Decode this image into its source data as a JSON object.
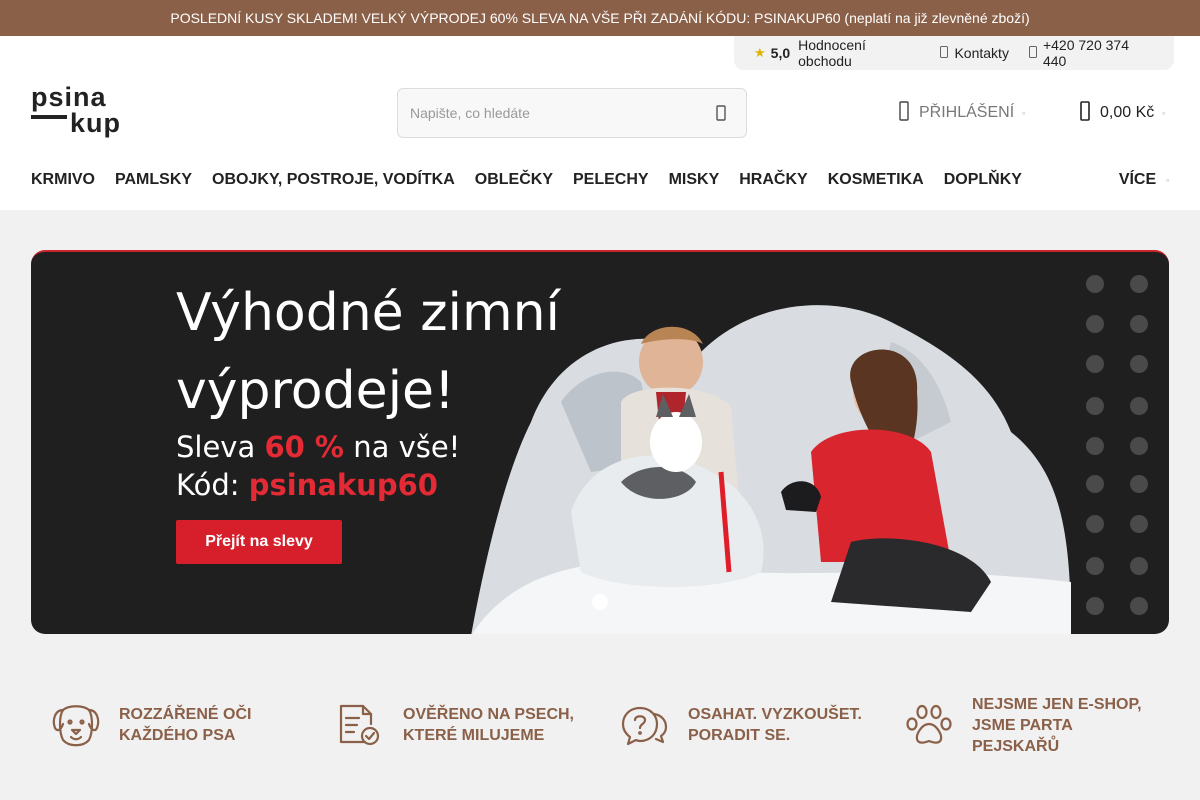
{
  "announcement": "POSLEDNÍ KUSY SKLADEM! VELKÝ VÝPRODEJ 60% SLEVA NA VŠE PŘI ZADÁNÍ KÓDU: PSINAKUP60 (neplatí na již zlevněné zboží)",
  "infobar": {
    "rating_value": "5,0",
    "rating_label": "Hodnocení obchodu",
    "contacts_label": "Kontakty",
    "phone": "+420 720 374 440"
  },
  "logo": {
    "line1": "psina",
    "line2": "kup"
  },
  "search": {
    "placeholder": "Napište, co hledáte"
  },
  "account": {
    "login_label": "PŘIHLÁŠENÍ"
  },
  "cart": {
    "total": "0,00 Kč"
  },
  "nav": {
    "items": [
      "KRMIVO",
      "PAMLSKY",
      "OBOJKY, POSTROJE, VODÍTKA",
      "OBLEČKY",
      "PELECHY",
      "MISKY",
      "HRAČKY",
      "KOSMETIKA",
      "DOPLŇKY"
    ],
    "more_label": "VÍCE"
  },
  "hero": {
    "title_line1": "Výhodné zimní",
    "title_line2": "výprodeje!",
    "discount_prefix": "Sleva ",
    "discount_value": "60 %",
    "discount_suffix": " na vše!",
    "code_prefix": "Kód: ",
    "code_value": "psinakup60",
    "cta_label": "Přejít na slevy"
  },
  "benefits": [
    {
      "line1": "ROZZÁŘENÉ OČI",
      "line2": "KAŽDÉHO PSA",
      "line3": ""
    },
    {
      "line1": "OVĚŘENO NA PSECH,",
      "line2": "KTERÉ MILUJEME",
      "line3": ""
    },
    {
      "line1": "OSAHAT. VYZKOUŠET.",
      "line2": "PORADIT SE.",
      "line3": ""
    },
    {
      "line1": "NEJSME JEN E-SHOP,",
      "line2": "JSME PARTA",
      "line3": "PEJSKAŘŮ"
    }
  ],
  "icons": {
    "rating": "star-icon",
    "contacts": "contact-icon",
    "phone": "phone-icon",
    "search": "search-icon",
    "login": "user-icon",
    "cart": "shopping-bag-icon",
    "benefits": [
      "dog-face-icon",
      "checklist-icon",
      "question-chat-icon",
      "paw-icon"
    ]
  },
  "colors": {
    "brand_brown": "#8b6049",
    "accent_red": "#d61f2b",
    "hero_bg": "#1f1f1f",
    "star": "#e2b200"
  }
}
